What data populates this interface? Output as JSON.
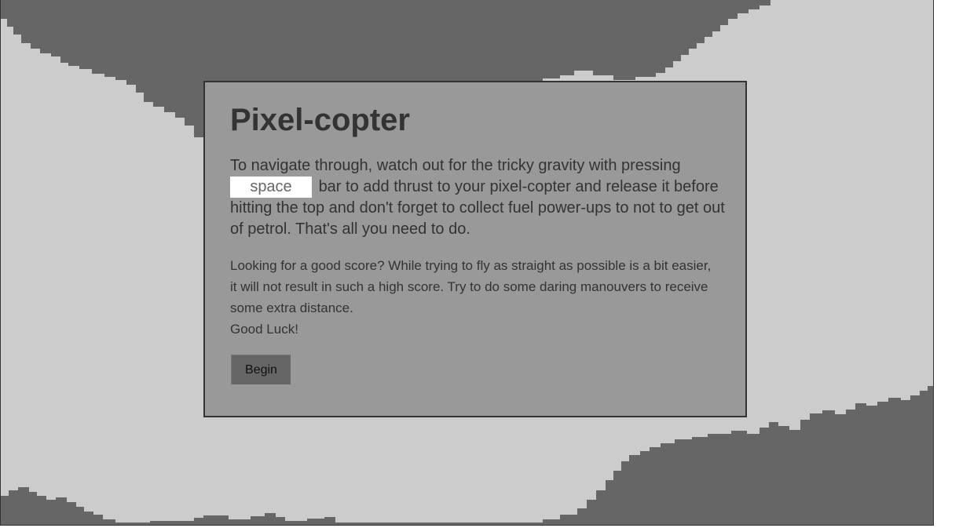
{
  "game": {
    "colors": {
      "background": "#cccccc",
      "cave_wall": "#666666",
      "dialog": "#999999",
      "border": "#333333"
    }
  },
  "dialog": {
    "title": "Pixel-copter",
    "instructions_before_key": "To navigate through, watch out for the tricky gravity with pressing",
    "key_label": "space",
    "instructions_after_key": "bar to add thrust to your pixel-copter and release it before hitting the top and don't forget to collect fuel power-ups to not to get out of petrol. That's all you need to do.",
    "tips": "Looking for a good score? While trying to fly as straight as possible is a bit easier, it will not result in such a high score. Try to do some daring manouvers to receive some extra distance.",
    "good_luck": "Good Luck!",
    "begin_label": "Begin"
  }
}
